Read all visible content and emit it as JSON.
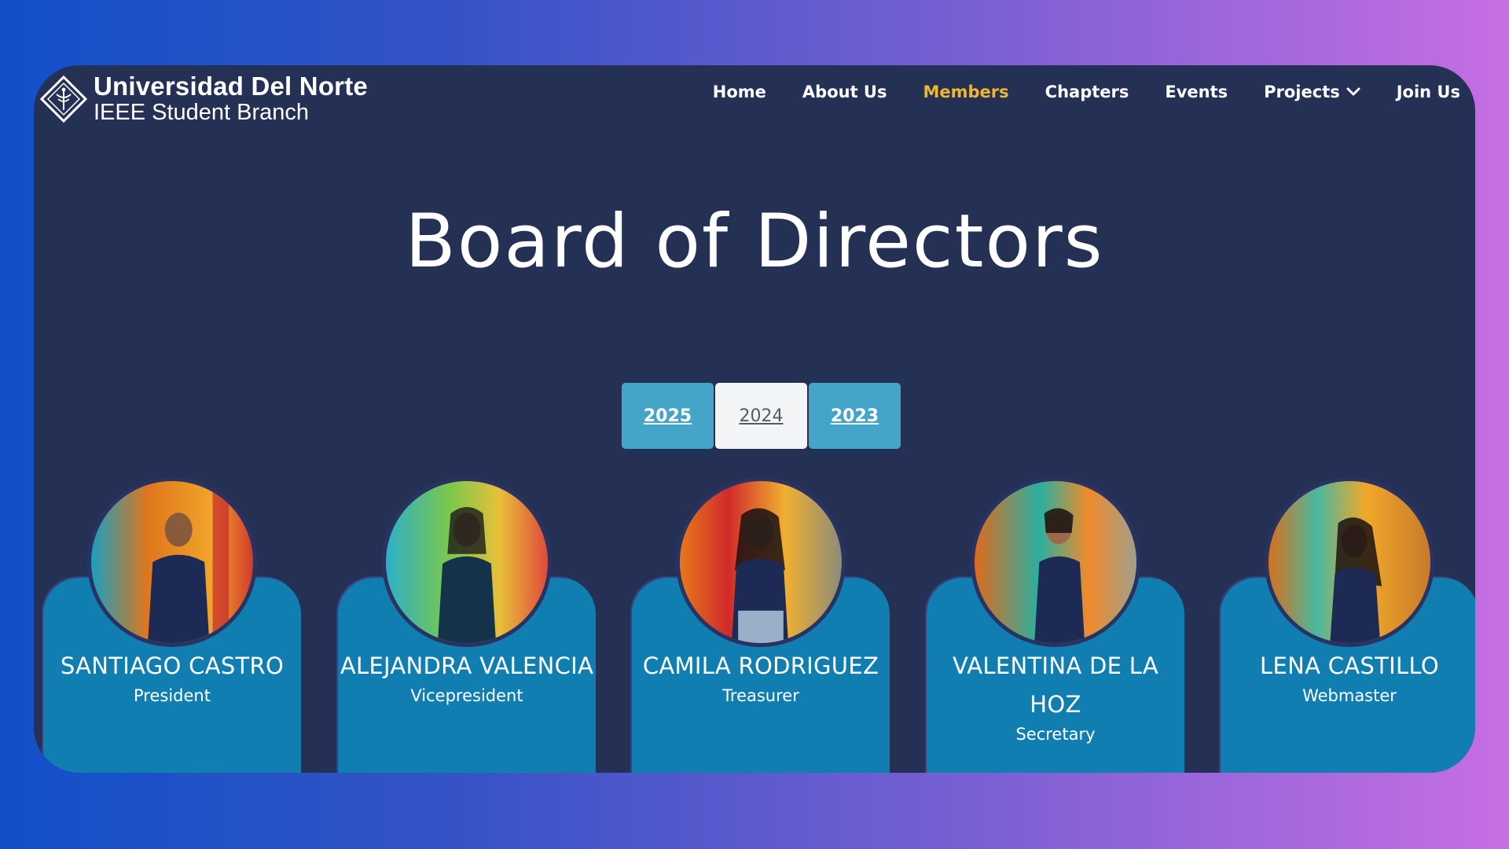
{
  "brand": {
    "title": "Universidad Del Norte",
    "subtitle": "IEEE Student Branch",
    "logo_icon": "ieee-diamond-logo-icon"
  },
  "nav": {
    "items": [
      {
        "label": "Home"
      },
      {
        "label": "About Us"
      },
      {
        "label": "Members",
        "active": true
      },
      {
        "label": "Chapters"
      },
      {
        "label": "Events"
      },
      {
        "label": "Projects",
        "dropdown": true
      },
      {
        "label": "Join Us"
      }
    ],
    "active_color": "#efb72c"
  },
  "page": {
    "title": "Board of Directors"
  },
  "years": {
    "tabs": [
      "2025",
      "2024",
      "2023"
    ],
    "selected": "2024"
  },
  "members": [
    {
      "name": "SANTIAGO CASTRO",
      "role": "President",
      "avatar_icon": "member-photo"
    },
    {
      "name": "ALEJANDRA VALENCIA",
      "role": "Vicepresident",
      "avatar_icon": "member-photo"
    },
    {
      "name": "CAMILA RODRIGUEZ",
      "role": "Treasurer",
      "avatar_icon": "member-photo"
    },
    {
      "name": "VALENTINA DE LA HOZ",
      "role": "Secretary",
      "avatar_icon": "member-photo"
    },
    {
      "name": "LENA CASTILLO",
      "role": "Webmaster",
      "avatar_icon": "member-photo"
    }
  ],
  "colors": {
    "panel": "#243155",
    "card": "#117eb2",
    "tab": "#44a5c8"
  }
}
